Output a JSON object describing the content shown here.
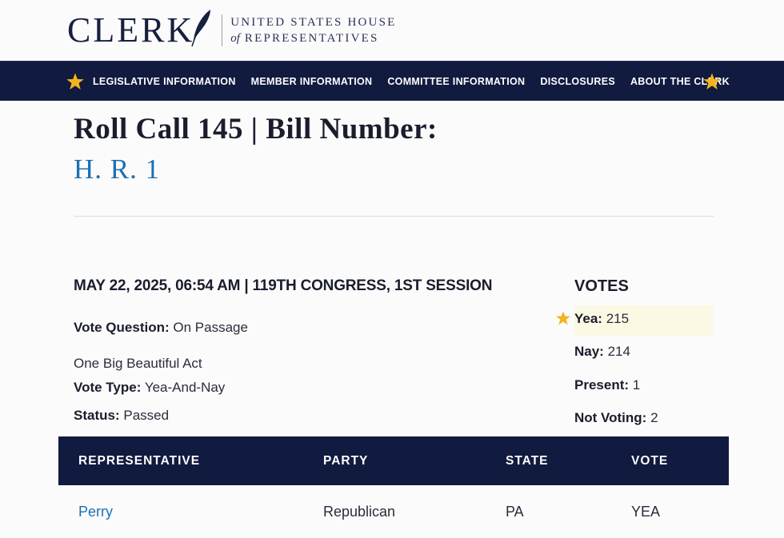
{
  "header": {
    "logo_word": "CLERK",
    "logo_line1": "UNITED STATES HOUSE",
    "logo_of": "of",
    "logo_line2": "REPRESENTATIVES"
  },
  "nav": {
    "items": [
      {
        "label": "LEGISLATIVE INFORMATION"
      },
      {
        "label": "MEMBER INFORMATION"
      },
      {
        "label": "COMMITTEE INFORMATION"
      },
      {
        "label": "DISCLOSURES"
      },
      {
        "label": "ABOUT THE CLERK"
      }
    ]
  },
  "page": {
    "title": "Roll Call 145 | Bill Number:",
    "bill_number": "H. R. 1"
  },
  "vote_info": {
    "session_line": "MAY 22, 2025, 06:54 AM | 119TH CONGRESS, 1ST SESSION",
    "question_label": "Vote Question:",
    "question_value": "On Passage",
    "description": "One Big Beautiful Act",
    "type_label": "Vote Type:",
    "type_value": "Yea-And-Nay",
    "status_label": "Status:",
    "status_value": "Passed"
  },
  "votes": {
    "heading": "VOTES",
    "yea_label": "Yea:",
    "yea_value": "215",
    "nay_label": "Nay:",
    "nay_value": "214",
    "present_label": "Present:",
    "present_value": "1",
    "not_voting_label": "Not Voting:",
    "not_voting_value": "2"
  },
  "table": {
    "headers": [
      "REPRESENTATIVE",
      "PARTY",
      "STATE",
      "VOTE"
    ],
    "rows": [
      {
        "representative": "Perry",
        "party": "Republican",
        "state": "PA",
        "vote": "YEA"
      }
    ]
  },
  "colors": {
    "navy": "#111a3f",
    "link_blue": "#1d6fb0",
    "star_gold": "#f2b51d",
    "yea_highlight": "#fbf8e3"
  },
  "icons": {
    "nav_left": "star-icon",
    "nav_right": "star-icon",
    "yea_marker": "star-icon",
    "logo": "quill-icon"
  }
}
